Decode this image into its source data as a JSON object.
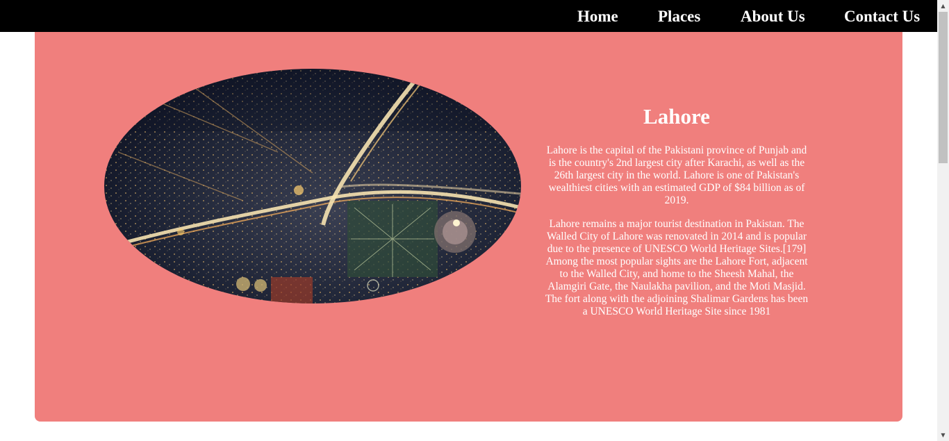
{
  "nav": {
    "items": [
      {
        "label": "Home"
      },
      {
        "label": "Places"
      },
      {
        "label": "About Us"
      },
      {
        "label": "Contact Us"
      }
    ]
  },
  "city": {
    "name": "Lahore",
    "paragraphs": [
      "Lahore is the capital of the Pakistani province of Punjab and is the country's 2nd largest city after Karachi, as well as the 26th largest city in the world. Lahore is one of Pakistan's wealthiest cities with an estimated GDP of $84 billion as of 2019.",
      "Lahore remains a major tourist destination in Pakistan. The Walled City of Lahore was renovated in 2014 and is popular due to the presence of UNESCO World Heritage Sites.[179] Among the most popular sights are the Lahore Fort, adjacent to the Walled City, and home to the Sheesh Mahal, the Alamgiri Gate, the Naulakha pavilion, and the Moti Masjid. The fort along with the adjoining Shalimar Gardens has been a UNESCO World Heritage Site since 1981"
    ]
  },
  "colors": {
    "navbar": "#000000",
    "card": "#f07f7d",
    "text": "#ffffff"
  },
  "icons": {
    "scroll_up": "scroll-up-arrow-icon",
    "scroll_down": "scroll-down-arrow-icon"
  }
}
